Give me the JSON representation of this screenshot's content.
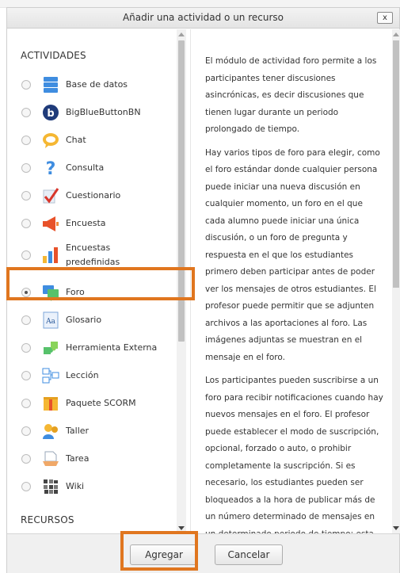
{
  "dialog": {
    "title": "Añadir una actividad o un recurso",
    "close_label": "x"
  },
  "sections": {
    "activities_heading": "ACTIVIDADES",
    "resources_heading": "RECURSOS"
  },
  "activities": [
    {
      "label": "Base de datos",
      "icon": "database-icon",
      "checked": false
    },
    {
      "label": "BigBlueButtonBN",
      "icon": "bigbluebutton-icon",
      "checked": false
    },
    {
      "label": "Chat",
      "icon": "chat-icon",
      "checked": false
    },
    {
      "label": "Consulta",
      "icon": "question-mark-icon",
      "checked": false
    },
    {
      "label": "Cuestionario",
      "icon": "quiz-checkmark-icon",
      "checked": false
    },
    {
      "label": "Encuesta",
      "icon": "megaphone-icon",
      "checked": false
    },
    {
      "label": "Encuestas predefinidas",
      "icon": "bar-chart-icon",
      "checked": false
    },
    {
      "label": "Foro",
      "icon": "forum-icon",
      "checked": true
    },
    {
      "label": "Glosario",
      "icon": "glossary-icon",
      "checked": false
    },
    {
      "label": "Herramienta Externa",
      "icon": "puzzle-icon",
      "checked": false
    },
    {
      "label": "Lección",
      "icon": "lesson-icon",
      "checked": false
    },
    {
      "label": "Paquete SCORM",
      "icon": "scorm-package-icon",
      "checked": false
    },
    {
      "label": "Taller",
      "icon": "workshop-icon",
      "checked": false
    },
    {
      "label": "Tarea",
      "icon": "assignment-icon",
      "checked": false
    },
    {
      "label": "Wiki",
      "icon": "wiki-icon",
      "checked": false
    }
  ],
  "description": {
    "paragraphs": [
      "El módulo de actividad foro permite a los participantes tener discusiones asincrónicas, es decir discusiones que tienen lugar durante un periodo prolongado de tiempo.",
      "Hay varios tipos de foro para elegir, como el foro estándar donde cualquier persona puede iniciar una nueva discusión en cualquier momento, un foro en el que cada alumno puede iniciar una única discusión, o un foro de pregunta y respuesta en el que los estudiantes primero deben participar antes de poder ver los mensajes de otros estudiantes. El profesor puede permitir que se adjunten archivos a las aportaciones al foro. Las imágenes adjuntas se muestran en el mensaje en el foro.",
      "Los participantes pueden suscribirse a un foro para recibir notificaciones cuando hay nuevos mensajes en el foro. El profesor puede establecer el modo de suscripción, opcional, forzado o auto, o prohibir completamente la suscripción. Si es necesario, los estudiantes pueden ser bloqueados a la hora de publicar más de un número determinado de mensajes en un determinado periodo de tiempo; esta medida puede evitar que determinadas personas"
    ]
  },
  "footer": {
    "add_label": "Agregar",
    "cancel_label": "Cancelar"
  },
  "colors": {
    "highlight": "#e0761f"
  }
}
